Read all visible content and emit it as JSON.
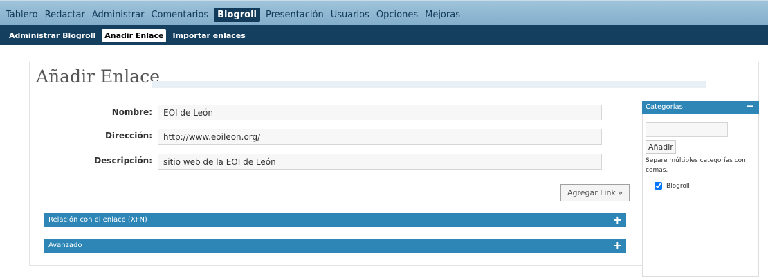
{
  "topnav": {
    "items": [
      "Tablero",
      "Redactar",
      "Administrar",
      "Comentarios",
      "Blogroll",
      "Presentación",
      "Usuarios",
      "Opciones",
      "Mejoras"
    ],
    "active_index": 4
  },
  "subnav": {
    "items": [
      "Administrar Blogroll",
      "Añadir Enlace",
      "Importar enlaces"
    ],
    "active_index": 1
  },
  "page": {
    "title": "Añadir Enlace"
  },
  "form": {
    "nombre_label": "Nombre:",
    "nombre_value": "EOI de León",
    "direccion_label": "Dirección:",
    "direccion_value": "http://www.eoileon.org/",
    "descripcion_label": "Descripción:",
    "descripcion_value": "sitio web de la EOI de León",
    "submit_label": "Agregar Link »"
  },
  "sections": {
    "xfn_label": "Relación con el enlace (XFN)",
    "avanzado_label": "Avanzado",
    "expand_glyph": "+"
  },
  "categories": {
    "header": "Categorías",
    "collapse_glyph": "−",
    "input_value": "",
    "add_label": "Añadir",
    "help_text": "Separe múltiples categorías con comas.",
    "items": [
      {
        "label": "Blogroll",
        "checked": true
      }
    ]
  },
  "colors": {
    "topnav_bg": "#9fc3da",
    "subnav_bg": "#143f5f",
    "section_bar": "#2e86b7",
    "text_dark": "#123a5a"
  }
}
